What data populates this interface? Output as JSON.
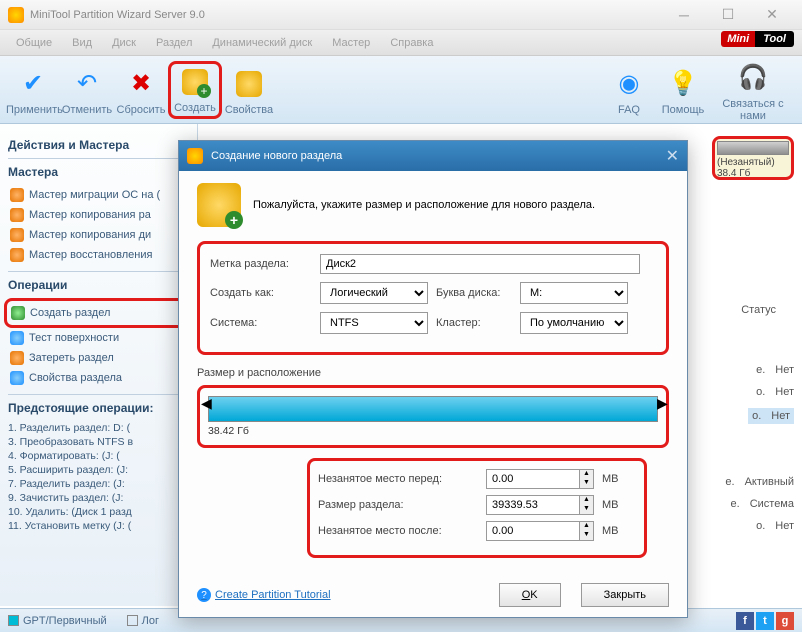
{
  "window": {
    "title": "MiniTool Partition Wizard Server 9.0"
  },
  "menu": {
    "i0": "Общие",
    "i1": "Вид",
    "i2": "Диск",
    "i3": "Раздел",
    "i4": "Динамический диск",
    "i5": "Мастер",
    "i6": "Справка"
  },
  "logo": {
    "p1": "Mini",
    "p2": "Tool"
  },
  "toolbar": {
    "apply": "Применить",
    "undo": "Отменить",
    "reset": "Сбросить",
    "create": "Создать",
    "props": "Свойства",
    "faq": "FAQ",
    "help": "Помощь",
    "contact": "Связаться с нами"
  },
  "sidebar": {
    "h1": "Действия и Мастера",
    "h2": "Мастера",
    "w0": "Мастер миграции ОС на (",
    "w1": "Мастер копирования ра",
    "w2": "Мастер копирования ди",
    "w3": "Мастер восстановления",
    "h3": "Операции",
    "op0": "Создать раздел",
    "op1": "Тест поверхности",
    "op2": "Затереть раздел",
    "op3": "Свойства раздела",
    "h4": "Предстоящие операции:",
    "p1": "1. Разделить раздел: D: (",
    "p2": "3. Преобразовать NTFS в",
    "p3": "4. Форматировать: (J: (",
    "p4": "5. Расширить раздел: (J:",
    "p5": "7. Разделить раздел: (J:",
    "p6": "9. Зачистить раздел: (J:",
    "p7": "10. Удалить: (Диск 1 разд",
    "p8": "11. Установить метку (J: ("
  },
  "footer": {
    "gpt": "GPT/Первичный",
    "log": "Лог"
  },
  "disk": {
    "label": "(Незанятый)",
    "size": "38.4 Гб"
  },
  "cols": {
    "status": "Статус"
  },
  "rows": {
    "r0": {
      "a": "е.",
      "b": "Нет"
    },
    "r1": {
      "a": "о.",
      "b": "Нет"
    },
    "r2": {
      "a": "о.",
      "b": "Нет"
    },
    "r3": {
      "a": "е.",
      "b": "Активный"
    },
    "r4": {
      "a": "е.",
      "b": "Система"
    },
    "r5": {
      "a": "о.",
      "b": "Нет"
    }
  },
  "dlg": {
    "title": "Создание нового раздела",
    "subtitle": "Пожалуйста, укажите размер и расположение для нового раздела.",
    "lbl_label": "Метка раздела:",
    "val_label": "Диск2",
    "lbl_createas": "Создать как:",
    "val_createas": "Логический",
    "lbl_letter": "Буква диска:",
    "val_letter": "M:",
    "lbl_system": "Система:",
    "val_system": "NTFS",
    "lbl_cluster": "Кластер:",
    "val_cluster": "По умолчанию",
    "fs_title": "Размер и расположение",
    "size_lbl": "38.42 Гб",
    "lbl_before": "Незанятое место перед:",
    "val_before": "0.00",
    "lbl_size": "Размер раздела:",
    "val_size": "39339.53",
    "lbl_after": "Незанятое место после:",
    "val_after": "0.00",
    "unit": "MB",
    "tutorial": "Create Partition Tutorial",
    "ok": "OK",
    "close": "Закрыть"
  }
}
